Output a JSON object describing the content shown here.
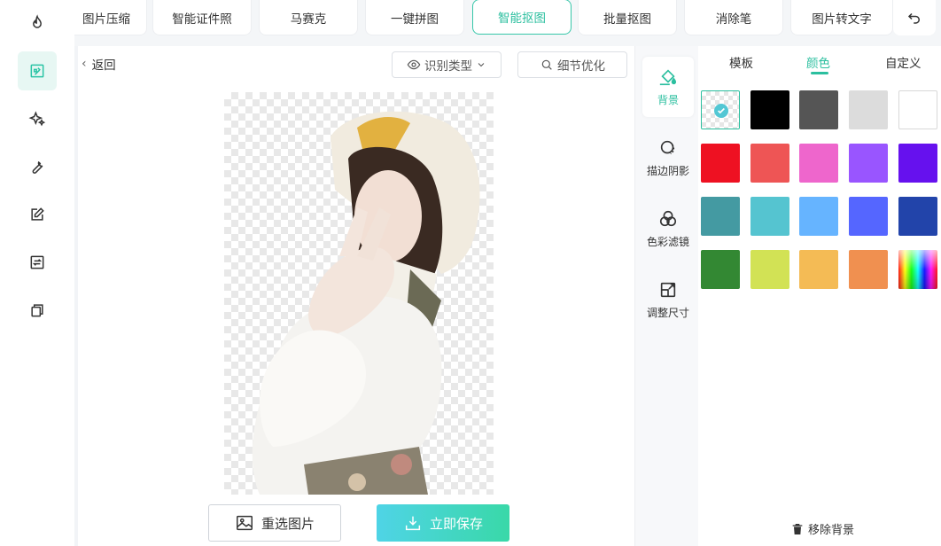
{
  "tabs": [
    {
      "label": "图片压缩",
      "active": false
    },
    {
      "label": "智能证件照",
      "active": false
    },
    {
      "label": "马赛克",
      "active": false
    },
    {
      "label": "一键拼图",
      "active": false
    },
    {
      "label": "智能抠图",
      "active": true
    },
    {
      "label": "批量抠图",
      "active": false
    },
    {
      "label": "消除笔",
      "active": false
    },
    {
      "label": "图片转文字",
      "active": false
    }
  ],
  "rail": [
    {
      "icon": "flame-icon",
      "active": false
    },
    {
      "icon": "image-edit-icon",
      "active": true
    },
    {
      "icon": "sparkle-icon",
      "active": false
    },
    {
      "icon": "wrench-icon",
      "active": false
    },
    {
      "icon": "pencil-square-icon",
      "active": false
    },
    {
      "icon": "convert-icon",
      "active": false
    },
    {
      "icon": "copy-icon",
      "active": false
    }
  ],
  "toolbar": {
    "back_label": "返回",
    "recognize_label": "识别类型",
    "detail_label": "细节优化"
  },
  "actions": {
    "reselect_label": "重选图片",
    "save_label": "立即保存"
  },
  "side_tools": [
    {
      "label": "背景",
      "icon": "paint-bucket-icon",
      "active": true
    },
    {
      "label": "描边阴影",
      "icon": "stroke-shadow-icon",
      "active": false
    },
    {
      "label": "色彩滤镜",
      "icon": "color-filter-icon",
      "active": false
    },
    {
      "label": "调整尺寸",
      "icon": "resize-icon",
      "active": false
    }
  ],
  "right_tabs": [
    {
      "label": "模板",
      "active": false
    },
    {
      "label": "颜色",
      "active": true
    },
    {
      "label": "自定义",
      "active": false
    }
  ],
  "colors": [
    "transparent",
    "#000000",
    "#555555",
    "#dcdcdc",
    "#ffffff",
    "#ee1122",
    "#ee5555",
    "#ee66cc",
    "#9955ff",
    "#6611ee",
    "#449aa2",
    "#55c4d0",
    "#66b4ff",
    "#5566ff",
    "#2244aa",
    "#338833",
    "#d2e255",
    "#f4bb55",
    "#f09050",
    "rainbow"
  ],
  "selected_color_index": 0,
  "remove_bg_label": "移除背景",
  "accent": "#2bbf9f"
}
